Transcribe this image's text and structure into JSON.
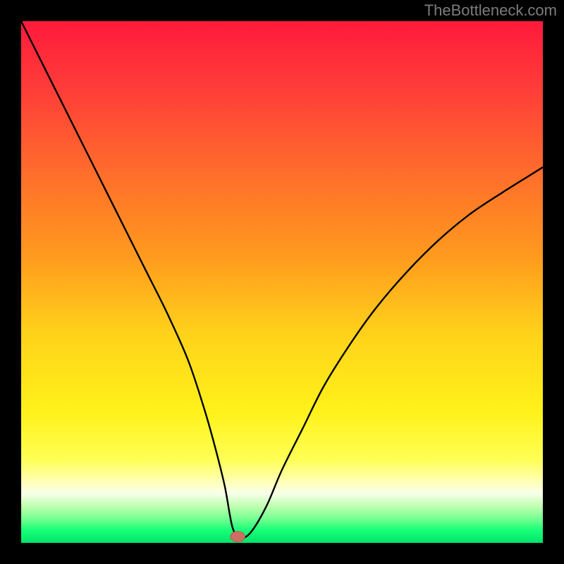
{
  "watermark": "TheBottleneck.com",
  "colors": {
    "frame": "#000000",
    "curve": "#000000",
    "marker_fill": "#cc6e62",
    "marker_stroke": "#b55a50",
    "gradient_stops": [
      {
        "offset": 0.0,
        "color": "#ff1a3b"
      },
      {
        "offset": 0.12,
        "color": "#ff3a3a"
      },
      {
        "offset": 0.28,
        "color": "#ff6a2c"
      },
      {
        "offset": 0.45,
        "color": "#ff9a1e"
      },
      {
        "offset": 0.6,
        "color": "#ffd21a"
      },
      {
        "offset": 0.75,
        "color": "#fff21a"
      },
      {
        "offset": 0.84,
        "color": "#ffff55"
      },
      {
        "offset": 0.88,
        "color": "#ffffb0"
      },
      {
        "offset": 0.905,
        "color": "#f8ffea"
      },
      {
        "offset": 0.93,
        "color": "#c0ffb0"
      },
      {
        "offset": 0.955,
        "color": "#70ff90"
      },
      {
        "offset": 0.975,
        "color": "#1aff78"
      },
      {
        "offset": 1.0,
        "color": "#00e56a"
      }
    ]
  },
  "chart_data": {
    "type": "line",
    "title": "",
    "xlabel": "",
    "ylabel": "",
    "xlim": [
      0,
      100
    ],
    "ylim": [
      0,
      100
    ],
    "grid": false,
    "legend": false,
    "series": [
      {
        "name": "bottleneck-curve",
        "x": [
          0,
          4,
          8,
          12,
          16,
          20,
          24,
          28,
          32,
          35,
          37,
          39,
          40.5,
          42,
          44,
          47,
          50,
          54,
          58,
          63,
          68,
          74,
          80,
          86,
          92,
          100
        ],
        "y": [
          100,
          92,
          84,
          76,
          68,
          60,
          52,
          44,
          35,
          26,
          19,
          11,
          3,
          1,
          2,
          7,
          14,
          22,
          30,
          38,
          45,
          52,
          58,
          63,
          67,
          72
        ]
      }
    ],
    "marker": {
      "x": 41.5,
      "y": 1.2,
      "rx": 1.4,
      "ry": 1.0
    }
  }
}
